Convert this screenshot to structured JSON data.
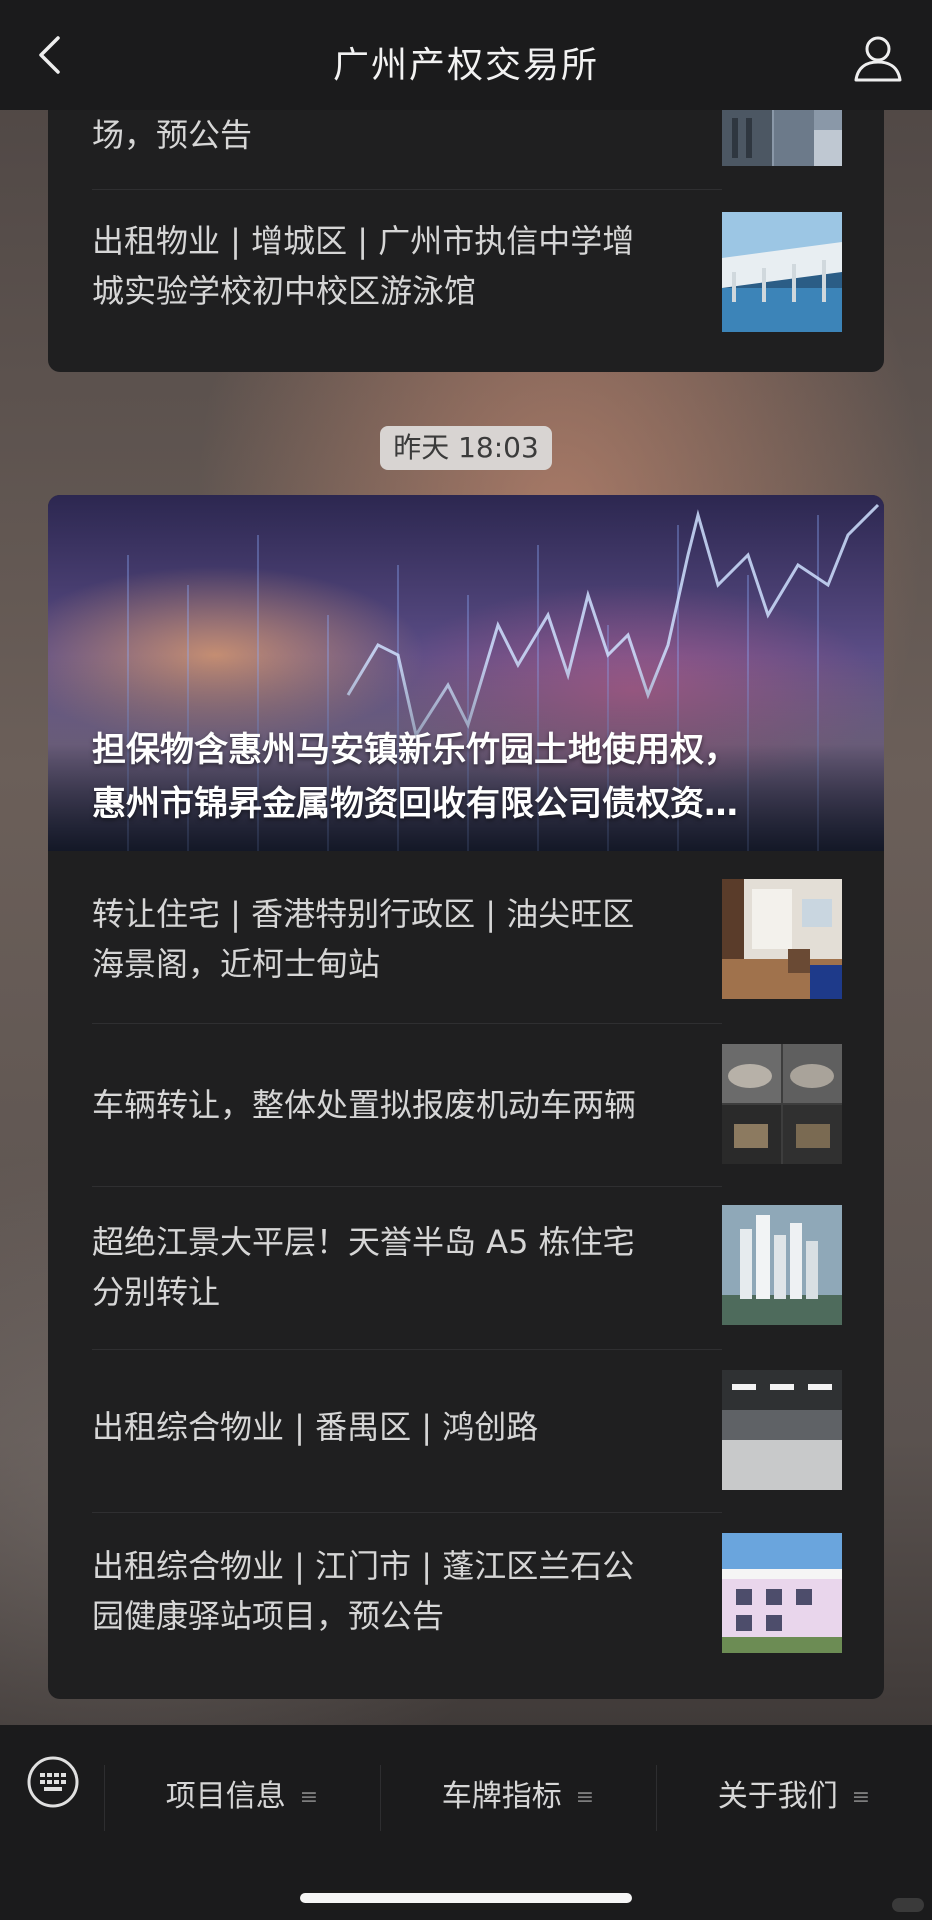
{
  "navbar": {
    "title": "广州产权交易所",
    "back_icon": "chevron-left-icon",
    "user_icon": "user-icon"
  },
  "top_card": {
    "items": [
      {
        "text": "场，预公告"
      },
      {
        "text": "出租物业 | 增城区 | 广州市执信中学增城实验学校初中校区游泳馆"
      }
    ]
  },
  "timestamp": "昨天 18:03",
  "main_card": {
    "hero_title": [
      "担保物含惠州马安镇新乐竹园土地使用权，",
      "惠州市锦昇金属物资回收有限公司债权资…"
    ],
    "items": [
      {
        "text": "转让住宅 | 香港特别行政区 | 油尖旺区海景阁，近柯士甸站"
      },
      {
        "text": "车辆转让，整体处置拟报废机动车两辆"
      },
      {
        "text": "超绝江景大平层！天誉半岛 A5 栋住宅分别转让"
      },
      {
        "text": "出租综合物业 | 番禺区 | 鸿创路"
      },
      {
        "text": "出租综合物业 | 江门市 | 蓬江区兰石公园健康驿站项目，预公告"
      }
    ]
  },
  "bottom_menu": {
    "keyboard_icon": "keyboard-icon",
    "items": [
      {
        "label": "项目信息"
      },
      {
        "label": "车牌指标"
      },
      {
        "label": "关于我们"
      }
    ],
    "menu_glyph": "≡"
  },
  "colors": {
    "bar_bg": "#1b1b1c",
    "card_bg": "#1f1f20",
    "text": "#d6d6d6"
  }
}
